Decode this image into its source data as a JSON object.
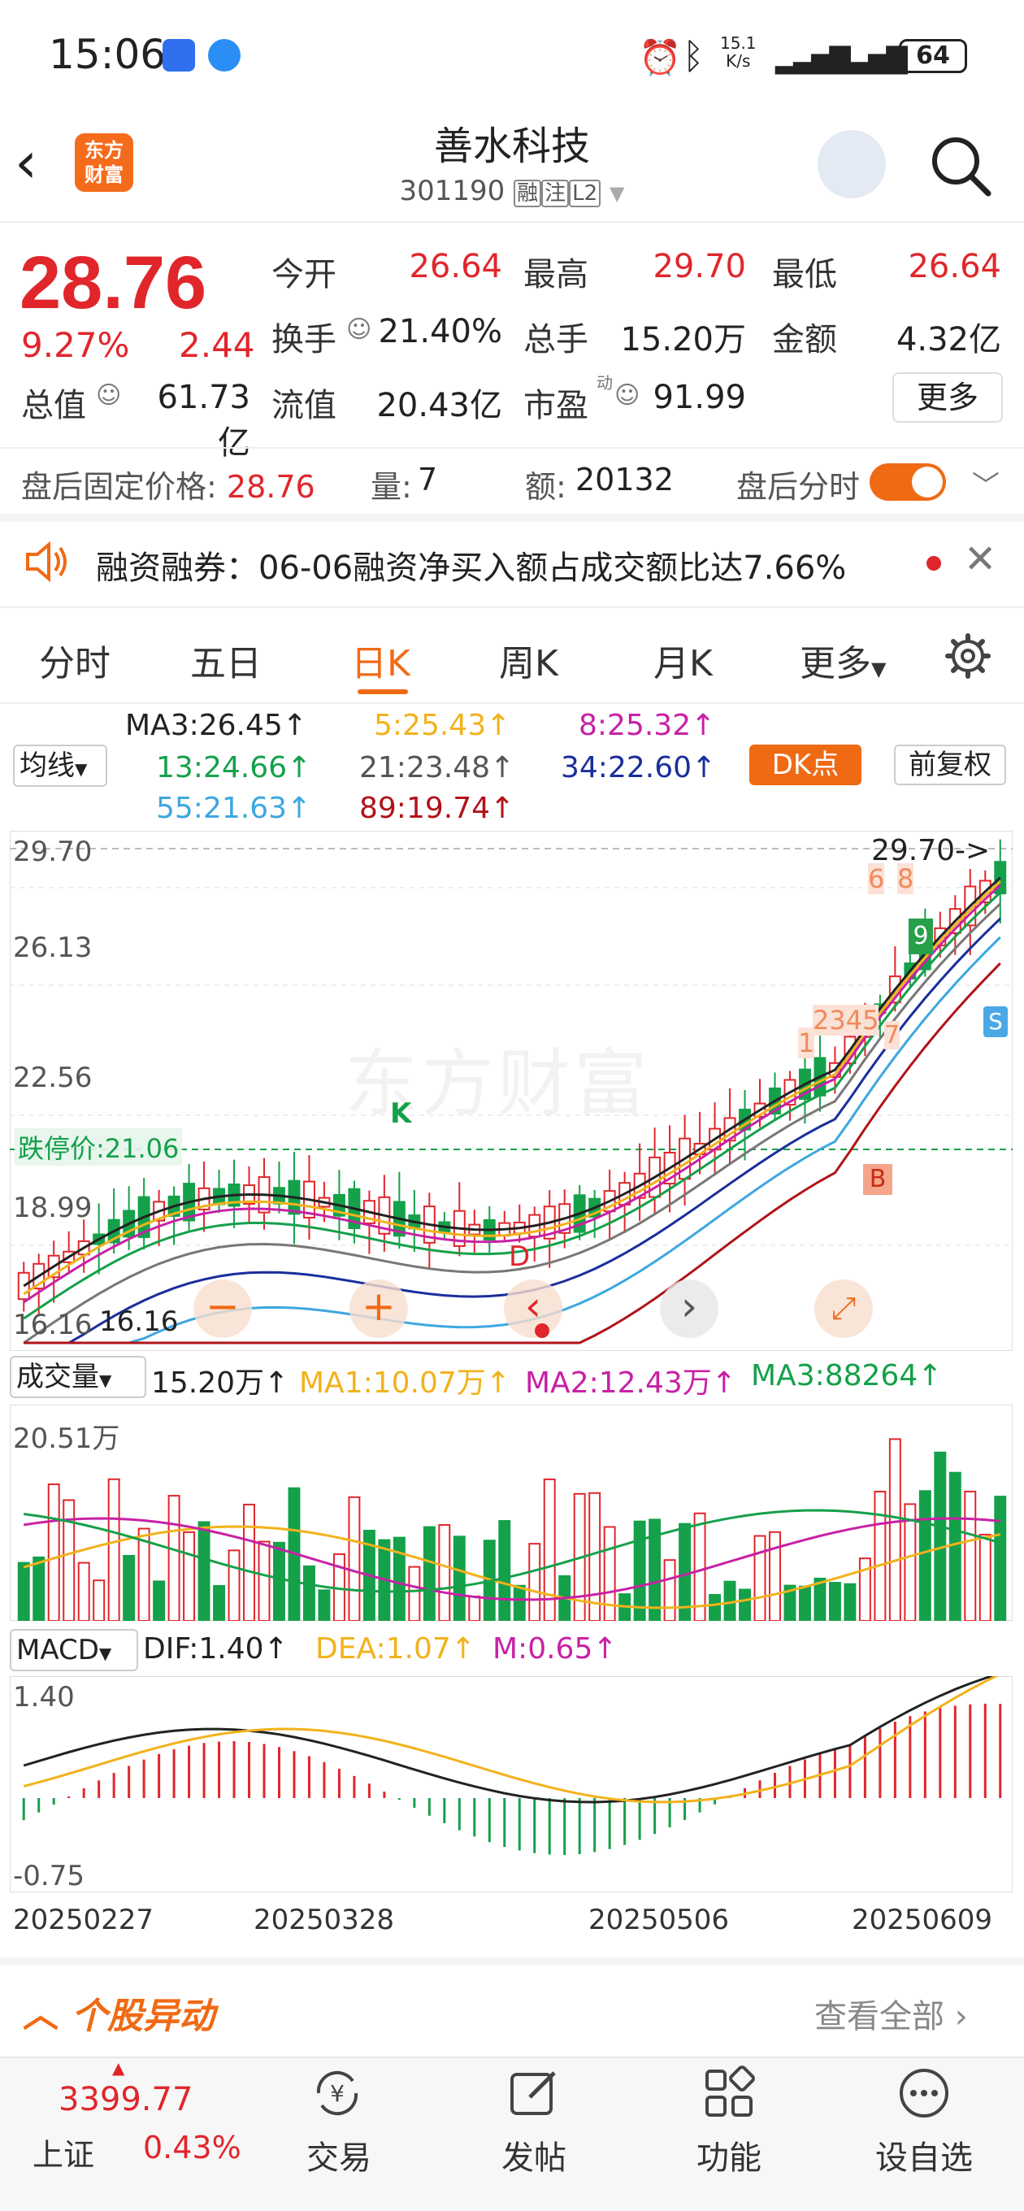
{
  "status": {
    "time": "15:06",
    "net_speed_top": "15.1",
    "net_speed_unit": "K/s",
    "battery": "64"
  },
  "header": {
    "title": "善水科技",
    "code": "301190",
    "tag1": "融",
    "tag2": "注",
    "tag3": "L2",
    "logo_line1": "东方",
    "logo_line2": "财富"
  },
  "quote": {
    "price": "28.76",
    "change_pct": "9.27%",
    "change": "2.44",
    "open_label": "今开",
    "open": "26.64",
    "high_label": "最高",
    "high": "29.70",
    "low_label": "最低",
    "low": "26.64",
    "turnover_label": "换手",
    "turnover": "21.40%",
    "volume_label": "总手",
    "volume": "15.20万",
    "amount_label": "金额",
    "amount": "4.32亿",
    "mktcap_label": "总值",
    "mktcap": "61.73亿",
    "float_label": "流值",
    "float": "20.43亿",
    "pe_label": "市盈",
    "pe_sup": "动",
    "pe": "91.99",
    "more_button": "更多"
  },
  "after_hours": {
    "label": "盘后固定价格:",
    "price": "28.76",
    "vol_label": "量:",
    "vol": "7",
    "amt_label": "额:",
    "amt": "20132",
    "toggle_label": "盘后分时"
  },
  "notice": {
    "text": "融资融券：06-06融资净买入额占成交额比达7.66%"
  },
  "tabs": [
    "分时",
    "五日",
    "日K",
    "周K",
    "月K",
    "更多"
  ],
  "kline": {
    "ma_selector": "均线",
    "ma3": "MA3:26.45↑",
    "ma5": "5:25.43↑",
    "ma8": "8:25.32↑",
    "ma13": "13:24.66↑",
    "ma21": "21:23.48↑",
    "ma34": "34:22.60↑",
    "ma55": "55:21.63↑",
    "ma89": "89:19.74↑",
    "dk_button": "DK点",
    "fq_button": "前复权",
    "y_ticks": [
      "29.70",
      "26.13",
      "22.56",
      "18.99",
      "16.16"
    ],
    "high_marker": "29.70->",
    "limit_down_label": "跌停价:21.06",
    "low_marker": "16.16",
    "watermark": "东方财富",
    "signal_labels": [
      "K",
      "D",
      "B",
      "S",
      "9",
      "1",
      "2345",
      "7",
      "6",
      "8"
    ]
  },
  "volume": {
    "selector": "成交量",
    "value": "15.20万↑",
    "ma1": "MA1:10.07万↑",
    "ma2": "MA2:12.43万↑",
    "ma3": "MA3:88264↑",
    "max_label": "20.51万"
  },
  "macd": {
    "selector": "MACD",
    "dif": "DIF:1.40↑",
    "dea": "DEA:1.07↑",
    "m": "M:0.65↑",
    "top": "1.40",
    "bottom": "-0.75"
  },
  "dates": [
    "20250227",
    "20250328",
    "20250506",
    "20250609"
  ],
  "movement": {
    "title": "个股异动",
    "view_all": "查看全部"
  },
  "bottom_nav": {
    "index_value": "3399.77",
    "index_name": "上证",
    "index_change": "0.43%",
    "items": [
      "交易",
      "发帖",
      "功能",
      "设自选"
    ]
  },
  "colors": {
    "up": "#e0262b",
    "down": "#15a04a",
    "accent": "#f06a14"
  }
}
